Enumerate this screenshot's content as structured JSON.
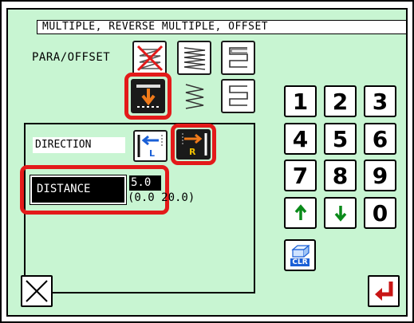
{
  "header": {
    "title": "MULTIPLE, REVERSE MULTIPLE, OFFSET"
  },
  "pattern": {
    "label": "PARA/OFFSET",
    "icons": [
      "crossed-zigzag-icon",
      "zigzag-right-icon",
      "reverse-loop-icon",
      "offset-down-icon",
      "zigzag-left-icon",
      "loop-left-icon"
    ],
    "selected": "offset-down-icon"
  },
  "direction": {
    "label": "DIRECTION",
    "left_label": "L",
    "right_label": "R",
    "selected": "R"
  },
  "distance": {
    "label": "DISTANCE",
    "value": "5.0",
    "range": "(0.0  20.0)"
  },
  "keypad": {
    "keys": [
      "1",
      "2",
      "3",
      "4",
      "5",
      "6",
      "7",
      "8",
      "9",
      "0"
    ],
    "clear_label": "CLR"
  },
  "colors": {
    "background": "#c8f5d2",
    "highlight": "#e31a1a",
    "accent_orange": "#f07a1a",
    "accent_green": "#0a8a1a"
  }
}
